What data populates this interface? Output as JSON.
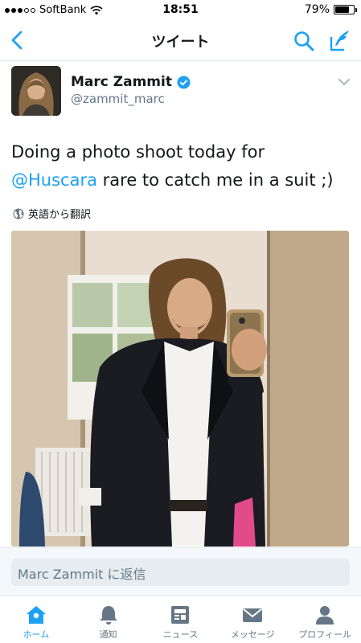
{
  "status_bar": {
    "carrier": "SoftBank",
    "time": "18:51",
    "battery": "79%",
    "battery_level": 0.79
  },
  "nav": {
    "title": "ツイート",
    "back_icon": "chevron-left-icon",
    "search_icon": "search-icon",
    "compose_icon": "compose-icon"
  },
  "tweet": {
    "display_name": "Marc Zammit",
    "handle": "@zammit_marc",
    "verified": true,
    "text_line1": "Doing a photo shoot today for",
    "mention": "@Huscara",
    "text_rest": " rare to catch me in a suit ;)",
    "translate_label": "英語から翻訳"
  },
  "reply": {
    "placeholder": "Marc Zammit に返信"
  },
  "tabs": [
    {
      "label": "ホーム",
      "icon": "home-icon",
      "active": true
    },
    {
      "label": "通知",
      "icon": "bell-icon",
      "active": false
    },
    {
      "label": "ニュース",
      "icon": "news-icon",
      "active": false
    },
    {
      "label": "メッセージ",
      "icon": "envelope-icon",
      "active": false
    },
    {
      "label": "プロフィール",
      "icon": "person-icon",
      "active": false
    }
  ],
  "colors": {
    "accent": "#1da1f2",
    "text": "#14171a",
    "secondary": "#657786"
  }
}
